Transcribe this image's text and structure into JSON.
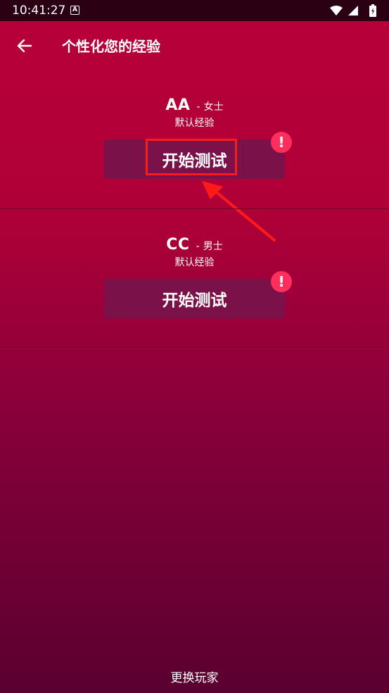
{
  "status_bar": {
    "time": "10:41:27",
    "a_icon_letter": "A"
  },
  "header": {
    "title": "个性化您的经验"
  },
  "profiles": [
    {
      "name": "AA",
      "separator": "-",
      "gender": "女士",
      "subtitle": "默认经验",
      "button_label": "开始测试",
      "alert_glyph": "!"
    },
    {
      "name": "CC",
      "separator": "-",
      "gender": "男士",
      "subtitle": "默认经验",
      "button_label": "开始测试",
      "alert_glyph": "!"
    }
  ],
  "footer": {
    "switch_player_label": "更换玩家"
  },
  "colors": {
    "accent_alert": "#ff2e5c",
    "button_bg": "#7a1148",
    "highlight": "#ff1a1a"
  }
}
